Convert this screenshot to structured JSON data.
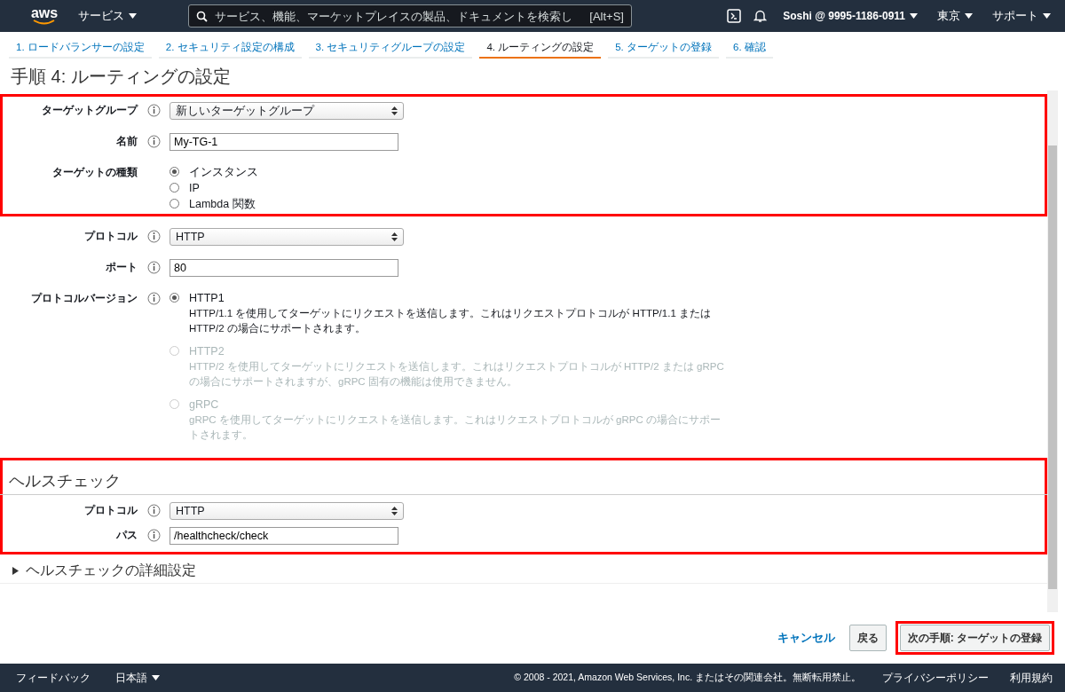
{
  "nav": {
    "logo": "aws",
    "services": "サービス",
    "search_placeholder": "サービス、機能、マーケットプレイスの製品、ドキュメントを検索し",
    "search_shortcut": "[Alt+S]",
    "account": "Soshi @ 9995-1186-0911",
    "region": "東京",
    "support": "サポート"
  },
  "steps": [
    {
      "label": "1. ロードバランサーの設定",
      "selected": false
    },
    {
      "label": "2. セキュリティ設定の構成",
      "selected": false
    },
    {
      "label": "3. セキュリティグループの設定",
      "selected": false
    },
    {
      "label": "4. ルーティングの設定",
      "selected": true
    },
    {
      "label": "5. ターゲットの登録",
      "selected": false
    },
    {
      "label": "6. 確認",
      "selected": false
    }
  ],
  "title": "手順 4: ルーティングの設定",
  "groups": [
    {
      "highlighted": true,
      "fields": [
        {
          "kind": "select",
          "label": "ターゲットグループ",
          "info": true,
          "value": "新しいターゲットグループ"
        },
        {
          "kind": "text",
          "label": "名前",
          "info": true,
          "value": "My-TG-1"
        },
        {
          "kind": "radio",
          "label": "ターゲットの種類",
          "info": false,
          "options": [
            {
              "label": "インスタンス",
              "selected": true,
              "disabled": false
            },
            {
              "label": "IP",
              "selected": false,
              "disabled": false
            },
            {
              "label": "Lambda 関数",
              "selected": false,
              "disabled": false
            }
          ]
        }
      ]
    },
    {
      "highlighted": false,
      "fields": [
        {
          "kind": "select",
          "label": "プロトコル",
          "info": true,
          "value": "HTTP"
        },
        {
          "kind": "text",
          "label": "ポート",
          "info": true,
          "value": "80"
        },
        {
          "kind": "radio",
          "label": "プロトコルバージョン",
          "info": true,
          "options": [
            {
              "label": "HTTP1",
              "description": "HTTP/1.1 を使用してターゲットにリクエストを送信します。これはリクエストプロトコルが HTTP/1.1 または HTTP/2 の場合にサポートされます。",
              "selected": true,
              "disabled": false
            },
            {
              "label": "HTTP2",
              "description": "HTTP/2 を使用してターゲットにリクエストを送信します。これはリクエストプロトコルが HTTP/2 または gRPC の場合にサポートされますが、gRPC 固有の機能は使用できません。",
              "selected": false,
              "disabled": true
            },
            {
              "label": "gRPC",
              "description": "gRPC を使用してターゲットにリクエストを送信します。これはリクエストプロトコルが gRPC の場合にサポートされます。",
              "selected": false,
              "disabled": true
            }
          ]
        }
      ]
    },
    {
      "highlighted": true,
      "heading": "ヘルスチェック",
      "fields": [
        {
          "kind": "select",
          "label": "プロトコル",
          "info": true,
          "value": "HTTP"
        },
        {
          "kind": "text",
          "label": "パス",
          "info": true,
          "value": "/healthcheck/check"
        }
      ]
    }
  ],
  "advanced": {
    "label": "ヘルスチェックの詳細設定",
    "expanded": false
  },
  "buttons": {
    "cancel": "キャンセル",
    "back": "戻る",
    "next": "次の手順: ターゲットの登録",
    "next_highlighted": true
  },
  "footer": {
    "feedback": "フィードバック",
    "language": "日本語",
    "copyright": "© 2008 - 2021, Amazon Web Services, Inc. またはその関連会社。無断転用禁止。",
    "privacy": "プライバシーポリシー",
    "terms": "利用規約"
  }
}
